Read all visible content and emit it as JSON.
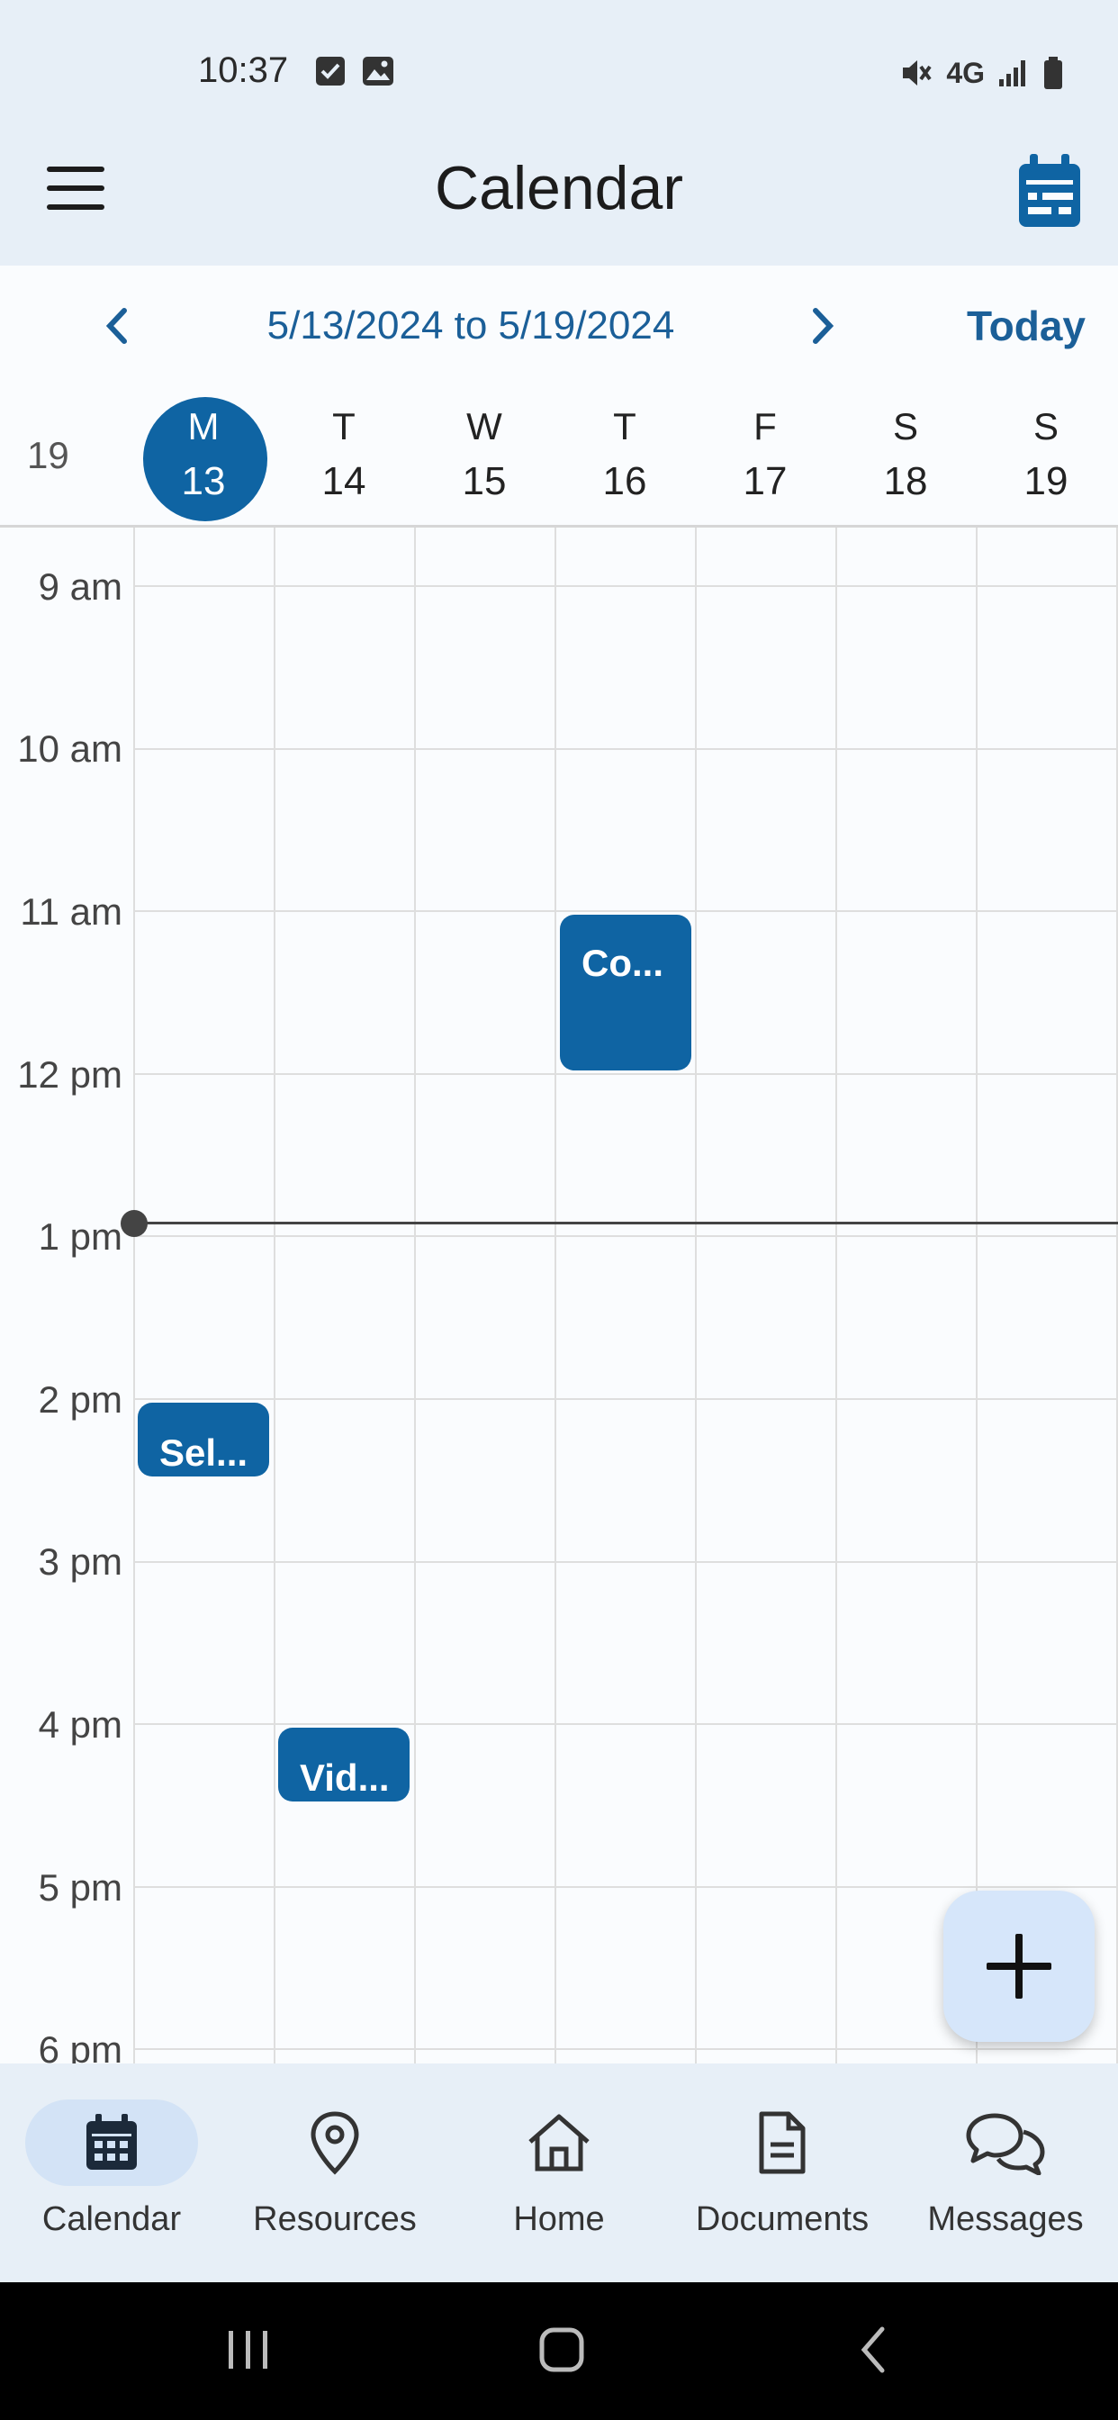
{
  "status_bar": {
    "time": "10:37",
    "left_icons": [
      "checkbox-icon",
      "image-icon"
    ],
    "right_icons": [
      "mute-icon",
      "4g-icon",
      "signal-icon",
      "battery-icon"
    ],
    "network": "4G"
  },
  "app_bar": {
    "title": "Calendar",
    "menu_icon": "menu-icon",
    "action_icon": "calendar-view-icon"
  },
  "week_nav": {
    "range": "5/13/2024 to 5/19/2024",
    "today_label": "Today"
  },
  "week_number": "19",
  "days": [
    {
      "letter": "M",
      "num": "13",
      "selected": true
    },
    {
      "letter": "T",
      "num": "14",
      "selected": false
    },
    {
      "letter": "W",
      "num": "15",
      "selected": false
    },
    {
      "letter": "T",
      "num": "16",
      "selected": false
    },
    {
      "letter": "F",
      "num": "17",
      "selected": false
    },
    {
      "letter": "S",
      "num": "18",
      "selected": false
    },
    {
      "letter": "S",
      "num": "19",
      "selected": false
    }
  ],
  "hours": [
    "9 am",
    "10 am",
    "11 am",
    "12 pm",
    "1 pm",
    "2 pm",
    "3 pm",
    "4 pm",
    "5 pm",
    "6 pm"
  ],
  "events": [
    {
      "label": "Co...",
      "day": "16",
      "start": "11 am",
      "end": "12 pm"
    },
    {
      "label": "Sel...",
      "day": "13",
      "start": "2 pm",
      "end": "2:30 pm"
    },
    {
      "label": "Vid...",
      "day": "14",
      "start": "4 pm",
      "end": "4:30 pm"
    }
  ],
  "current_time_marker": "1 pm",
  "fab": {
    "icon": "plus-icon"
  },
  "bottom_nav": [
    {
      "label": "Calendar",
      "icon": "calendar-icon",
      "active": true
    },
    {
      "label": "Resources",
      "icon": "location-pin-icon",
      "active": false
    },
    {
      "label": "Home",
      "icon": "home-icon",
      "active": false
    },
    {
      "label": "Documents",
      "icon": "document-icon",
      "active": false
    },
    {
      "label": "Messages",
      "icon": "chat-icon",
      "active": false
    }
  ],
  "colors": {
    "accent": "#0f64a3",
    "link": "#1b5f98",
    "bar_bg": "#e7eff7",
    "fab_bg": "#d6e6fa"
  }
}
